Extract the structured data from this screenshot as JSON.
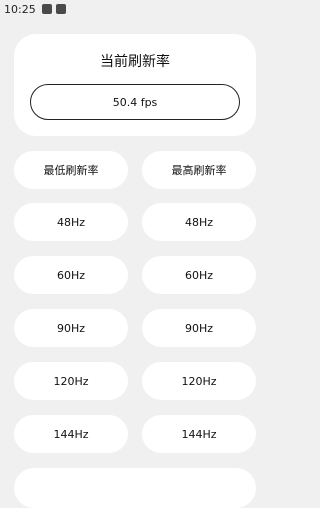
{
  "status_bar": {
    "time": "10:25"
  },
  "card": {
    "title": "当前刷新率",
    "fps": "50.4 fps"
  },
  "columns": {
    "min_label": "最低刷新率",
    "max_label": "最高刷新率"
  },
  "rates": [
    "48Hz",
    "60Hz",
    "90Hz",
    "120Hz",
    "144Hz"
  ]
}
